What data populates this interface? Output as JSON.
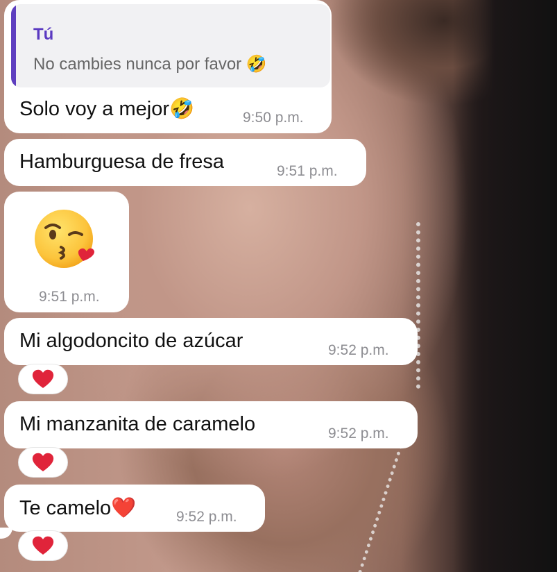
{
  "reply": {
    "author": "Tú",
    "quoted_text": "No cambies nunca por favor 🤣"
  },
  "messages": [
    {
      "text": "Solo voy a mejor",
      "emoji": "🤣",
      "time": "9:50 p.m."
    },
    {
      "text": "Hamburguesa de fresa",
      "time": "9:51 p.m."
    },
    {
      "emoji_only": "😘",
      "time": "9:51 p.m."
    },
    {
      "text": "Mi algodoncito de azúcar",
      "time": "9:52 p.m.",
      "reaction": "❤️"
    },
    {
      "text": "Mi manzanita de caramelo",
      "time": "9:52 p.m.",
      "reaction": "❤️"
    },
    {
      "text": "Te camelo",
      "emoji": "❤️",
      "time": "9:52 p.m.",
      "reaction": "❤️"
    }
  ],
  "colors": {
    "bubble": "#ffffff",
    "reply_accent": "#5e3fbf",
    "reply_background": "#f1f1f3",
    "timestamp": "#8d8d92",
    "heart": "#e0243a"
  }
}
